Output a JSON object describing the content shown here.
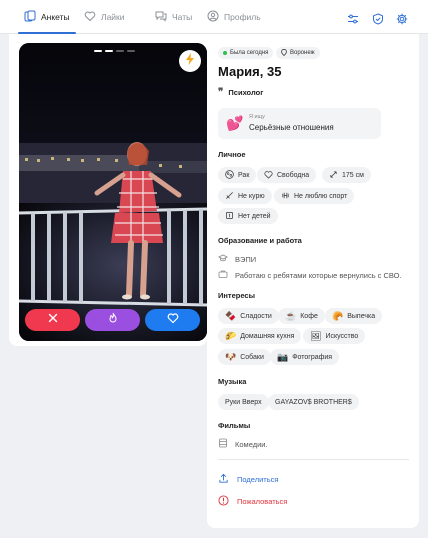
{
  "nav": {
    "tabs": [
      {
        "label": "Анкеты",
        "icon": "cards-icon"
      },
      {
        "label": "Лайки",
        "icon": "heart-icon"
      },
      {
        "label": "Чаты",
        "icon": "chat-icon"
      },
      {
        "label": "Профиль",
        "icon": "user-icon"
      }
    ],
    "right_icons": [
      "filter-icon",
      "shield-icon",
      "gear-icon"
    ]
  },
  "profile": {
    "status": "Была сегодня",
    "city": "Воронеж",
    "name_age": "Мария, 35",
    "profession": "Психолог",
    "seeking_label": "Я ищу",
    "seeking_value": "Серьёзные отношения"
  },
  "sections": {
    "personal": "Личное",
    "education": "Образование и работа",
    "interests": "Интересы",
    "music": "Музыка",
    "films": "Фильмы"
  },
  "personal": [
    "Рак",
    "Свободна",
    "175 см",
    "Не курю",
    "Не люблю спорт",
    "Нет детей"
  ],
  "education": {
    "school": "ВЭПИ",
    "work": "Работаю с ребятами которые вернулись с СВО."
  },
  "interests": [
    "Сладости",
    "Кофе",
    "Выпечка",
    "Домашняя кухня",
    "Искусство",
    "Собаки",
    "Фотография"
  ],
  "music": [
    "Руки Вверх",
    "GAYAZOV$ BROTHER$"
  ],
  "films": "Комедии.",
  "actions": {
    "share": "Поделиться",
    "report": "Пожаловаться"
  },
  "colors": {
    "accent": "#2f6fd6",
    "dislike": "#f0394f",
    "super": "#9b4fe0",
    "like": "#1f7cf0",
    "online": "#2fbf4f",
    "report": "#e0333e"
  }
}
